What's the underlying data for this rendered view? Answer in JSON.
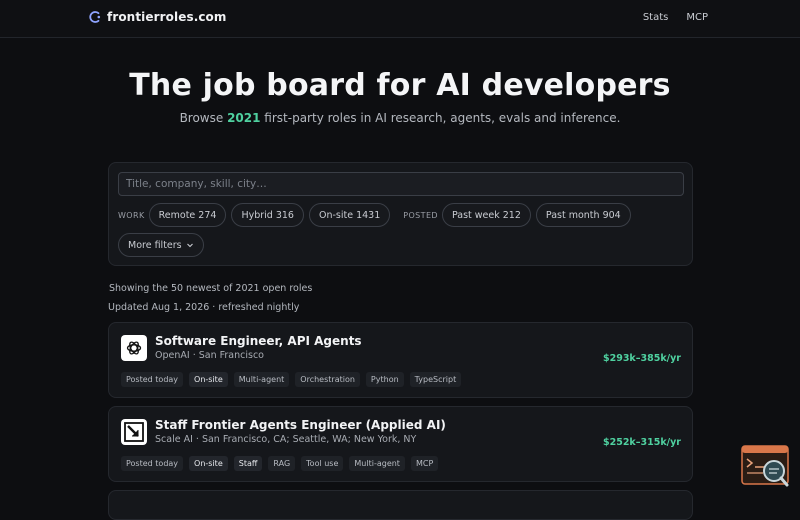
{
  "brand": {
    "name": "frontierroles.com",
    "icon": "brand-logo-icon"
  },
  "nav": [
    {
      "label": "Stats"
    },
    {
      "label": "MCP"
    }
  ],
  "hero": {
    "title": "The job board for AI developers",
    "sub_prefix": "Browse ",
    "count": "2021",
    "sub_suffix": " first-party roles in AI research, agents, evals and inference."
  },
  "search": {
    "placeholder": "Title, company, skill, city…",
    "value": ""
  },
  "filters": {
    "work_label": "WORK",
    "work": [
      {
        "label": "Remote 274"
      },
      {
        "label": "Hybrid 316"
      },
      {
        "label": "On-site 1431"
      }
    ],
    "posted_label": "POSTED",
    "posted": [
      {
        "label": "Past week 212"
      },
      {
        "label": "Past month 904"
      }
    ],
    "more_label": "More filters",
    "more_icon": "chevron-down-icon"
  },
  "showing": "Showing the 50 newest of 2021 open roles",
  "updated": "Updated Aug 1, 2026 · refreshed nightly",
  "jobs": [
    {
      "title": "Software Engineer, API Agents",
      "meta": "OpenAI · San Francisco",
      "salary": "$293k–385k/yr",
      "logo": "openai-logo-icon",
      "tags": [
        "Posted today",
        "On-site",
        "Multi-agent",
        "Orchestration",
        "Python",
        "TypeScript"
      ]
    },
    {
      "title": "Staff Frontier Agents Engineer (Applied AI)",
      "meta": "Scale AI · San Francisco, CA; Seattle, WA; New York, NY",
      "salary": "$252k–315k/yr",
      "logo": "scale-logo-icon",
      "tags": [
        "Posted today",
        "On-site",
        "Staff",
        "RAG",
        "Tool use",
        "Multi-agent",
        "MCP"
      ]
    }
  ],
  "colors": {
    "accent": "#4fd1a0",
    "background": "#0d0e11",
    "card": "#15171b"
  }
}
